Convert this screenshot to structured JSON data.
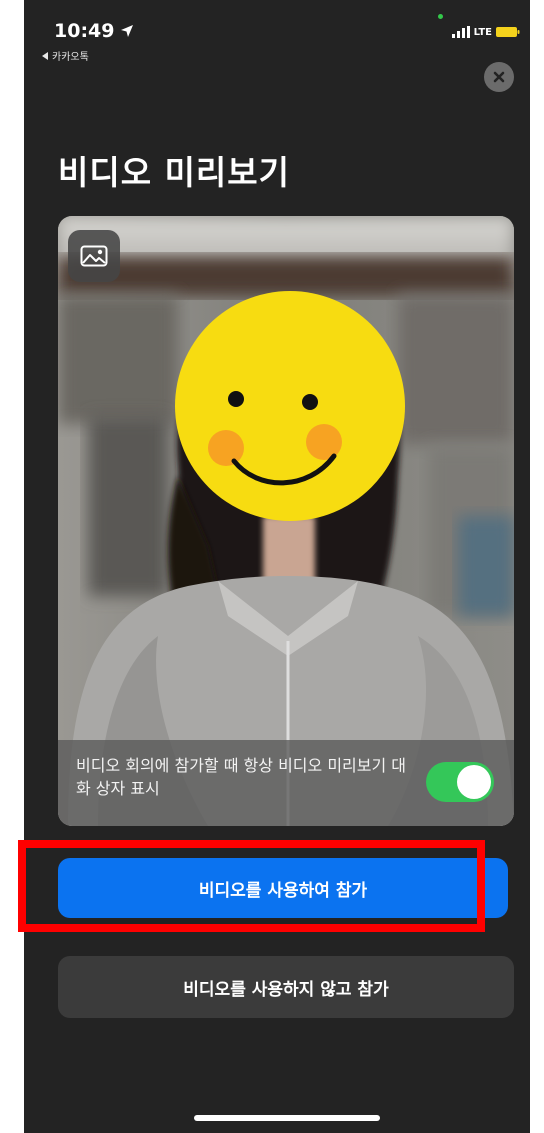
{
  "status_bar": {
    "time": "10:49",
    "back_app": "카카오톡",
    "network": "LTE"
  },
  "page": {
    "title": "비디오 미리보기"
  },
  "preview": {
    "caption": "비디오 회의에 참가할 때 항상 비디오 미리보기 대화 상자 표시",
    "always_show_toggle": "on"
  },
  "buttons": {
    "join_with_video": "비디오를 사용하여 참가",
    "join_without_video": "비디오를 사용하지 않고 참가"
  },
  "colors": {
    "background": "#232323",
    "primary_button": "#0b73f0",
    "secondary_button": "#3b3b3b",
    "toggle_on": "#34c759",
    "highlight": "#ff0000"
  },
  "icons": [
    "location-arrow-icon",
    "back-arrow-icon",
    "signal-bars-icon",
    "battery-icon",
    "close-icon",
    "gallery-icon"
  ]
}
